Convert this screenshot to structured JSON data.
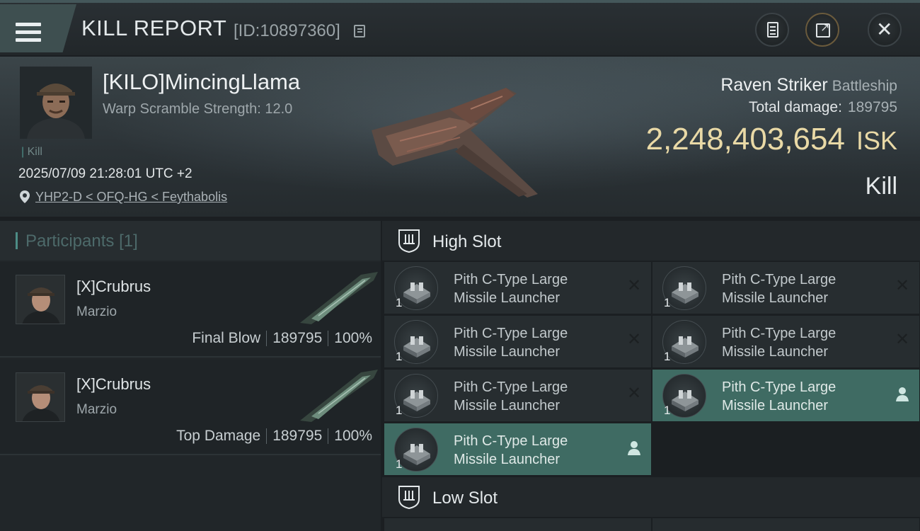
{
  "header": {
    "title": "KILL REPORT",
    "report_id": "[ID:10897360]"
  },
  "victim": {
    "name": "[KILO]MincingLlama",
    "warp_scramble": "Warp Scramble Strength: 12.0",
    "kill_tag": "Kill",
    "datetime": "2025/07/09 21:28:01 UTC +2",
    "location": "YHP2-D < OFQ-HG < Feythabolis",
    "ship_name": "Raven Striker",
    "ship_class": "Battleship",
    "total_damage_label": "Total damage:",
    "total_damage": "189795",
    "isk_value": "2,248,403,654",
    "isk_unit": "ISK",
    "result": "Kill"
  },
  "participants": {
    "title": "Participants",
    "count": "[1]",
    "rows": [
      {
        "name": "[X]Crubrus",
        "corp": "Marzio",
        "role": "Final Blow",
        "damage": "189795",
        "percent": "100%"
      },
      {
        "name": "[X]Crubrus",
        "corp": "Marzio",
        "role": "Top Damage",
        "damage": "189795",
        "percent": "100%"
      }
    ]
  },
  "high_slot": {
    "title": "High Slot",
    "modules": [
      {
        "qty": "1",
        "line1": "Pith C-Type Large",
        "line2": "Missile Launcher",
        "status": "destroyed"
      },
      {
        "qty": "1",
        "line1": "Pith C-Type Large",
        "line2": "Missile Launcher",
        "status": "destroyed"
      },
      {
        "qty": "1",
        "line1": "Pith C-Type Large",
        "line2": "Missile Launcher",
        "status": "destroyed"
      },
      {
        "qty": "1",
        "line1": "Pith C-Type Large",
        "line2": "Missile Launcher",
        "status": "destroyed"
      },
      {
        "qty": "1",
        "line1": "Pith C-Type Large",
        "line2": "Missile Launcher",
        "status": "destroyed"
      },
      {
        "qty": "1",
        "line1": "Pith C-Type Large",
        "line2": "Missile Launcher",
        "status": "dropped"
      },
      {
        "qty": "1",
        "line1": "Pith C-Type Large",
        "line2": "Missile Launcher",
        "status": "dropped"
      }
    ]
  },
  "low_slot": {
    "title": "Low Slot"
  },
  "icons": {
    "menu": "hamburger-icon",
    "copy": "copy-icon",
    "clipboard": "clipboard-icon",
    "share": "share-icon",
    "close": "close-icon",
    "pin": "location-pin-icon",
    "destroyed": "x-mark-icon",
    "dropped": "person-icon"
  },
  "colors": {
    "accent": "#4d8d86",
    "isk": "#e9d9a6",
    "active_module": "#3f6b63"
  }
}
